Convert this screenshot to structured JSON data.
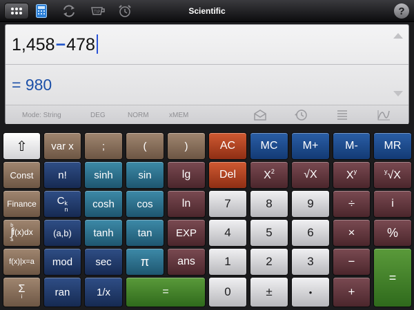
{
  "app": {
    "title": "Scientific",
    "help_label": "?"
  },
  "display": {
    "expression_left": "1,458",
    "expression_op": "−",
    "expression_right": "478",
    "result": "= 980",
    "status": {
      "mode": "Mode: String",
      "angle": "DEG",
      "format": "NORM",
      "memory": "xMEM"
    }
  },
  "keys": {
    "shift": "⇧",
    "var_x": "var x",
    "semicolon": ";",
    "paren_open": "(",
    "paren_close": ")",
    "ac": "AC",
    "mc": "MC",
    "m_plus": "M+",
    "m_minus": "M-",
    "mr": "MR",
    "const": "Const",
    "factorial": "n!",
    "sinh": "sinh",
    "sin": "sin",
    "lg": "lg",
    "del": "Del",
    "x_squared": "X",
    "x_squared_sup": "2",
    "sqrt": "√X",
    "x_power": "X",
    "x_power_sup": "y",
    "nth_root": "√X",
    "nth_root_pre": "y",
    "finance": "Finance",
    "combination": "C",
    "combination_sub": "n",
    "combination_sup": "k",
    "cosh": "cosh",
    "cos": "cos",
    "ln": "ln",
    "d7": "7",
    "d8": "8",
    "d9": "9",
    "divide": "÷",
    "i": "i",
    "integral": "f(x)dx",
    "integral_sign": "∫",
    "integral_upper": "b",
    "integral_lower": "a",
    "interval": "(a,b)",
    "tanh": "tanh",
    "tan": "tan",
    "exp": "EXP",
    "d4": "4",
    "d5": "5",
    "d6": "6",
    "multiply": "×",
    "percent": "%",
    "eval_at": "f(x)|x=a",
    "mod": "mod",
    "sec": "sec",
    "pi": "π",
    "ans": "ans",
    "d1": "1",
    "d2": "2",
    "d3": "3",
    "minus": "−",
    "equals_big": "=",
    "sum": "Σ",
    "sum_lower": "i",
    "ran": "ran",
    "reciprocal": "1/x",
    "equals_wide": "=",
    "d0": "0",
    "plus_minus": "±",
    "dot": "•",
    "plus": "+"
  }
}
